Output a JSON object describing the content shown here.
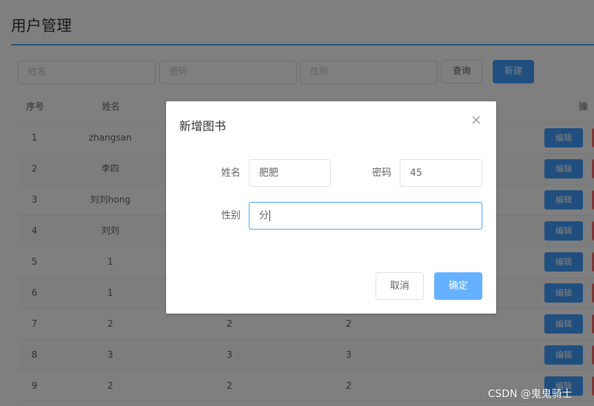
{
  "header": {
    "title": "用户管理"
  },
  "filters": {
    "name_placeholder": "姓名",
    "password_placeholder": "密码",
    "gender_placeholder": "性别",
    "query_label": "查询",
    "new_label": "新建"
  },
  "table": {
    "headers": {
      "index": "序号",
      "name": "姓名",
      "actions": "操作"
    },
    "edit_label": "编辑",
    "rows": [
      {
        "index": "1",
        "name": "zhangsan",
        "password": "",
        "gender": ""
      },
      {
        "index": "2",
        "name": "李四",
        "password": "",
        "gender": ""
      },
      {
        "index": "3",
        "name": "刘刘hong",
        "password": "",
        "gender": ""
      },
      {
        "index": "4",
        "name": "刘刘",
        "password": "",
        "gender": ""
      },
      {
        "index": "5",
        "name": "1",
        "password": "",
        "gender": ""
      },
      {
        "index": "6",
        "name": "1",
        "password": "",
        "gender": ""
      },
      {
        "index": "7",
        "name": "2",
        "password": "2",
        "gender": "2"
      },
      {
        "index": "8",
        "name": "3",
        "password": "3",
        "gender": "3"
      },
      {
        "index": "9",
        "name": "2",
        "password": "2",
        "gender": "2"
      }
    ]
  },
  "dialog": {
    "title": "新增图书",
    "name_label": "姓名",
    "name_value": "肥肥",
    "password_label": "密码",
    "password_value": "45",
    "gender_label": "性别",
    "gender_value": "分",
    "cancel_label": "取消",
    "confirm_label": "确定"
  },
  "watermark": "CSDN @鬼鬼骑士",
  "colors": {
    "primary": "#409eff",
    "danger": "#f56c6c",
    "confirm_disabled": "#66b1ff"
  }
}
